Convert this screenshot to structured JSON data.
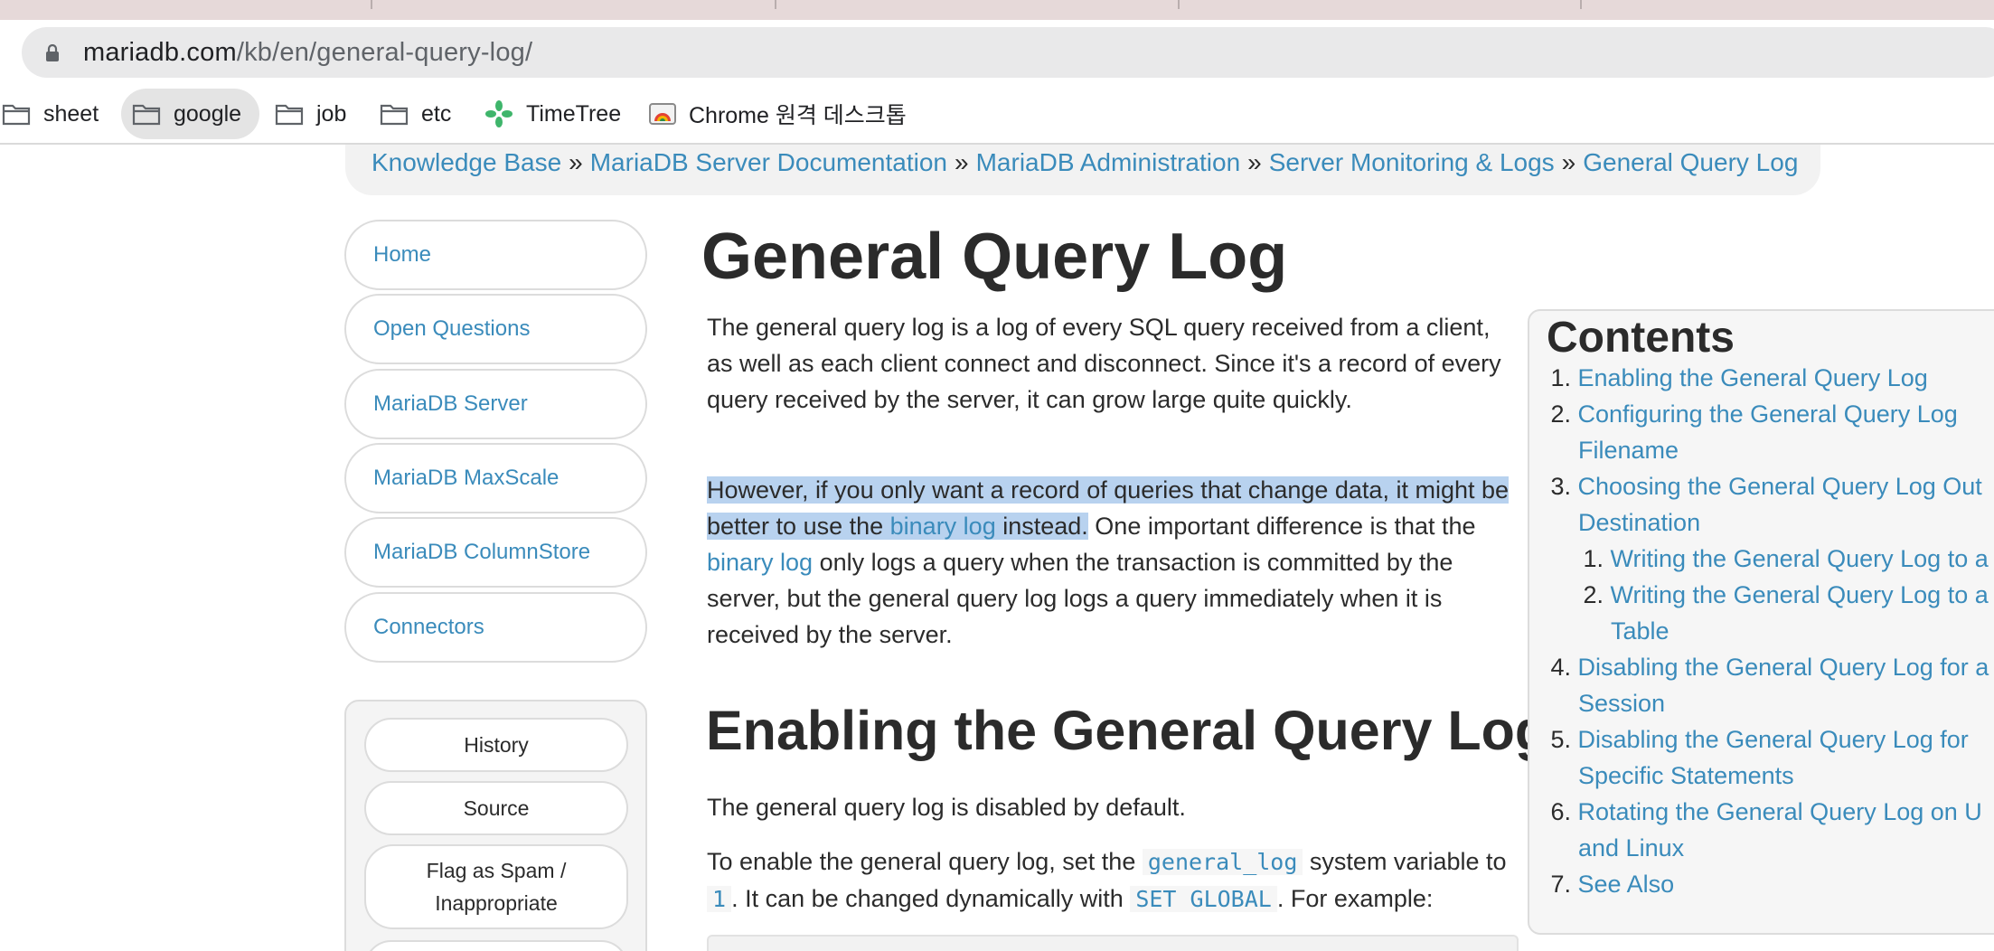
{
  "browser": {
    "url_host": "mariadb.com",
    "url_path": "/kb/en/general-query-log/",
    "bookmarks": [
      {
        "label": "sheet",
        "icon": "folder-icon"
      },
      {
        "label": "google",
        "icon": "folder-icon"
      },
      {
        "label": "job",
        "icon": "folder-icon"
      },
      {
        "label": "etc",
        "icon": "folder-icon"
      },
      {
        "label": "TimeTree",
        "icon": "timetree-icon"
      },
      {
        "label": "Chrome 원격 데스크톱",
        "icon": "chrome-remote-desktop-icon"
      }
    ]
  },
  "breadcrumb": {
    "items": [
      "Knowledge Base",
      "MariaDB Server Documentation",
      "MariaDB Administration",
      "Server Monitoring & Logs",
      "General Query Log"
    ],
    "separator": "»"
  },
  "sidebar": {
    "nav": [
      "Home",
      "Open Questions",
      "MariaDB Server",
      "MariaDB MaxScale",
      "MariaDB ColumnStore",
      "Connectors"
    ],
    "actions": [
      "History",
      "Source",
      "Flag as Spam / Inappropriate"
    ]
  },
  "article": {
    "title": "General Query Log",
    "p1": "The general query log is a log of every SQL query received from a client, as well as each client connect and disconnect. Since it's a record of every query received by the server, it can grow large quite quickly.",
    "p2": {
      "hl_a": "However, if you only want a record of queries that change data, it might be better to use the ",
      "link1": "binary log",
      "hl_b": " instead.",
      "b": " One important difference is that the ",
      "link2": "binary log",
      "c": " only logs a query when the transaction is committed by the server, but the general query log logs a query immediately when it is received by the server."
    },
    "h2": "Enabling the General Query Log",
    "p3": "The general query log is disabled by default.",
    "p4": {
      "a": "To enable the general query log, set the ",
      "code1": "general_log",
      "b": " system variable to ",
      "code2": "1",
      "c": ". It can be changed dynamically with ",
      "code3": "SET GLOBAL",
      "d": ". For example:"
    }
  },
  "toc": {
    "title": "Contents",
    "items": [
      {
        "num": "1.",
        "text": "Enabling the General Query Log"
      },
      {
        "num": "2.",
        "text": "Configuring the General Query Log"
      },
      {
        "num": "",
        "text": "Filename"
      },
      {
        "num": "3.",
        "text": "Choosing the General Query Log Out"
      },
      {
        "num": "",
        "text": "Destination"
      },
      {
        "num": "1.",
        "text": "Writing the General Query Log to a"
      },
      {
        "num": "2.",
        "text": "Writing the General Query Log to a"
      },
      {
        "num": "",
        "text": "Table"
      },
      {
        "num": "4.",
        "text": "Disabling the General Query Log for a"
      },
      {
        "num": "",
        "text": "Session"
      },
      {
        "num": "5.",
        "text": "Disabling the General Query Log for"
      },
      {
        "num": "",
        "text": "Specific Statements"
      },
      {
        "num": "6.",
        "text": "Rotating the General Query Log on U"
      },
      {
        "num": "",
        "text": "and Linux"
      },
      {
        "num": "7.",
        "text": "See Also"
      }
    ]
  },
  "colors": {
    "link": "#3a8bbb",
    "highlight": "#b8d2ef",
    "text": "#2b2b2b"
  }
}
